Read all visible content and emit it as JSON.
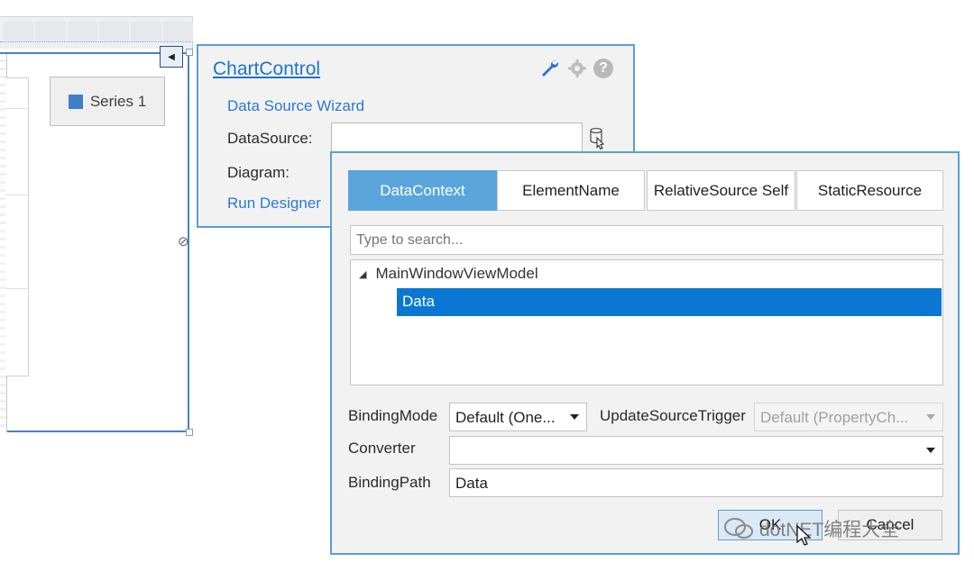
{
  "designer": {
    "legend": {
      "series_name": "Series 1",
      "swatch_color": "#3f7fc5"
    }
  },
  "chart_panel": {
    "title": "ChartControl",
    "links": {
      "wizard": "Data Source Wizard",
      "run_designer": "Run Designer"
    },
    "fields": {
      "datasource_label": "DataSource:",
      "diagram_label": "Diagram:"
    },
    "icons": [
      "wrench-icon",
      "gear-icon",
      "help-icon",
      "database-icon"
    ]
  },
  "binding_editor": {
    "tabs": [
      {
        "label": "DataContext",
        "active": true
      },
      {
        "label": "ElementName",
        "active": false
      },
      {
        "label": "RelativeSource Self",
        "active": false
      },
      {
        "label": "StaticResource",
        "active": false
      }
    ],
    "search_placeholder": "Type to search...",
    "tree": {
      "root": "MainWindowViewModel",
      "selected_child": "Data"
    },
    "binding_mode": {
      "label": "BindingMode",
      "value": "Default (One..."
    },
    "update_source_trigger": {
      "label": "UpdateSourceTrigger",
      "value": "Default (PropertyCh..."
    },
    "converter": {
      "label": "Converter",
      "value": ""
    },
    "binding_path": {
      "label": "BindingPath",
      "value": "Data"
    },
    "buttons": {
      "ok": "OK",
      "cancel": "Cancel"
    }
  },
  "watermark": {
    "text": "dotNET编程大全"
  },
  "colors": {
    "accent": "#5aa6dc",
    "selection": "#0a78d2",
    "link": "#2a7ad2",
    "frame": "#5a9fd4"
  }
}
